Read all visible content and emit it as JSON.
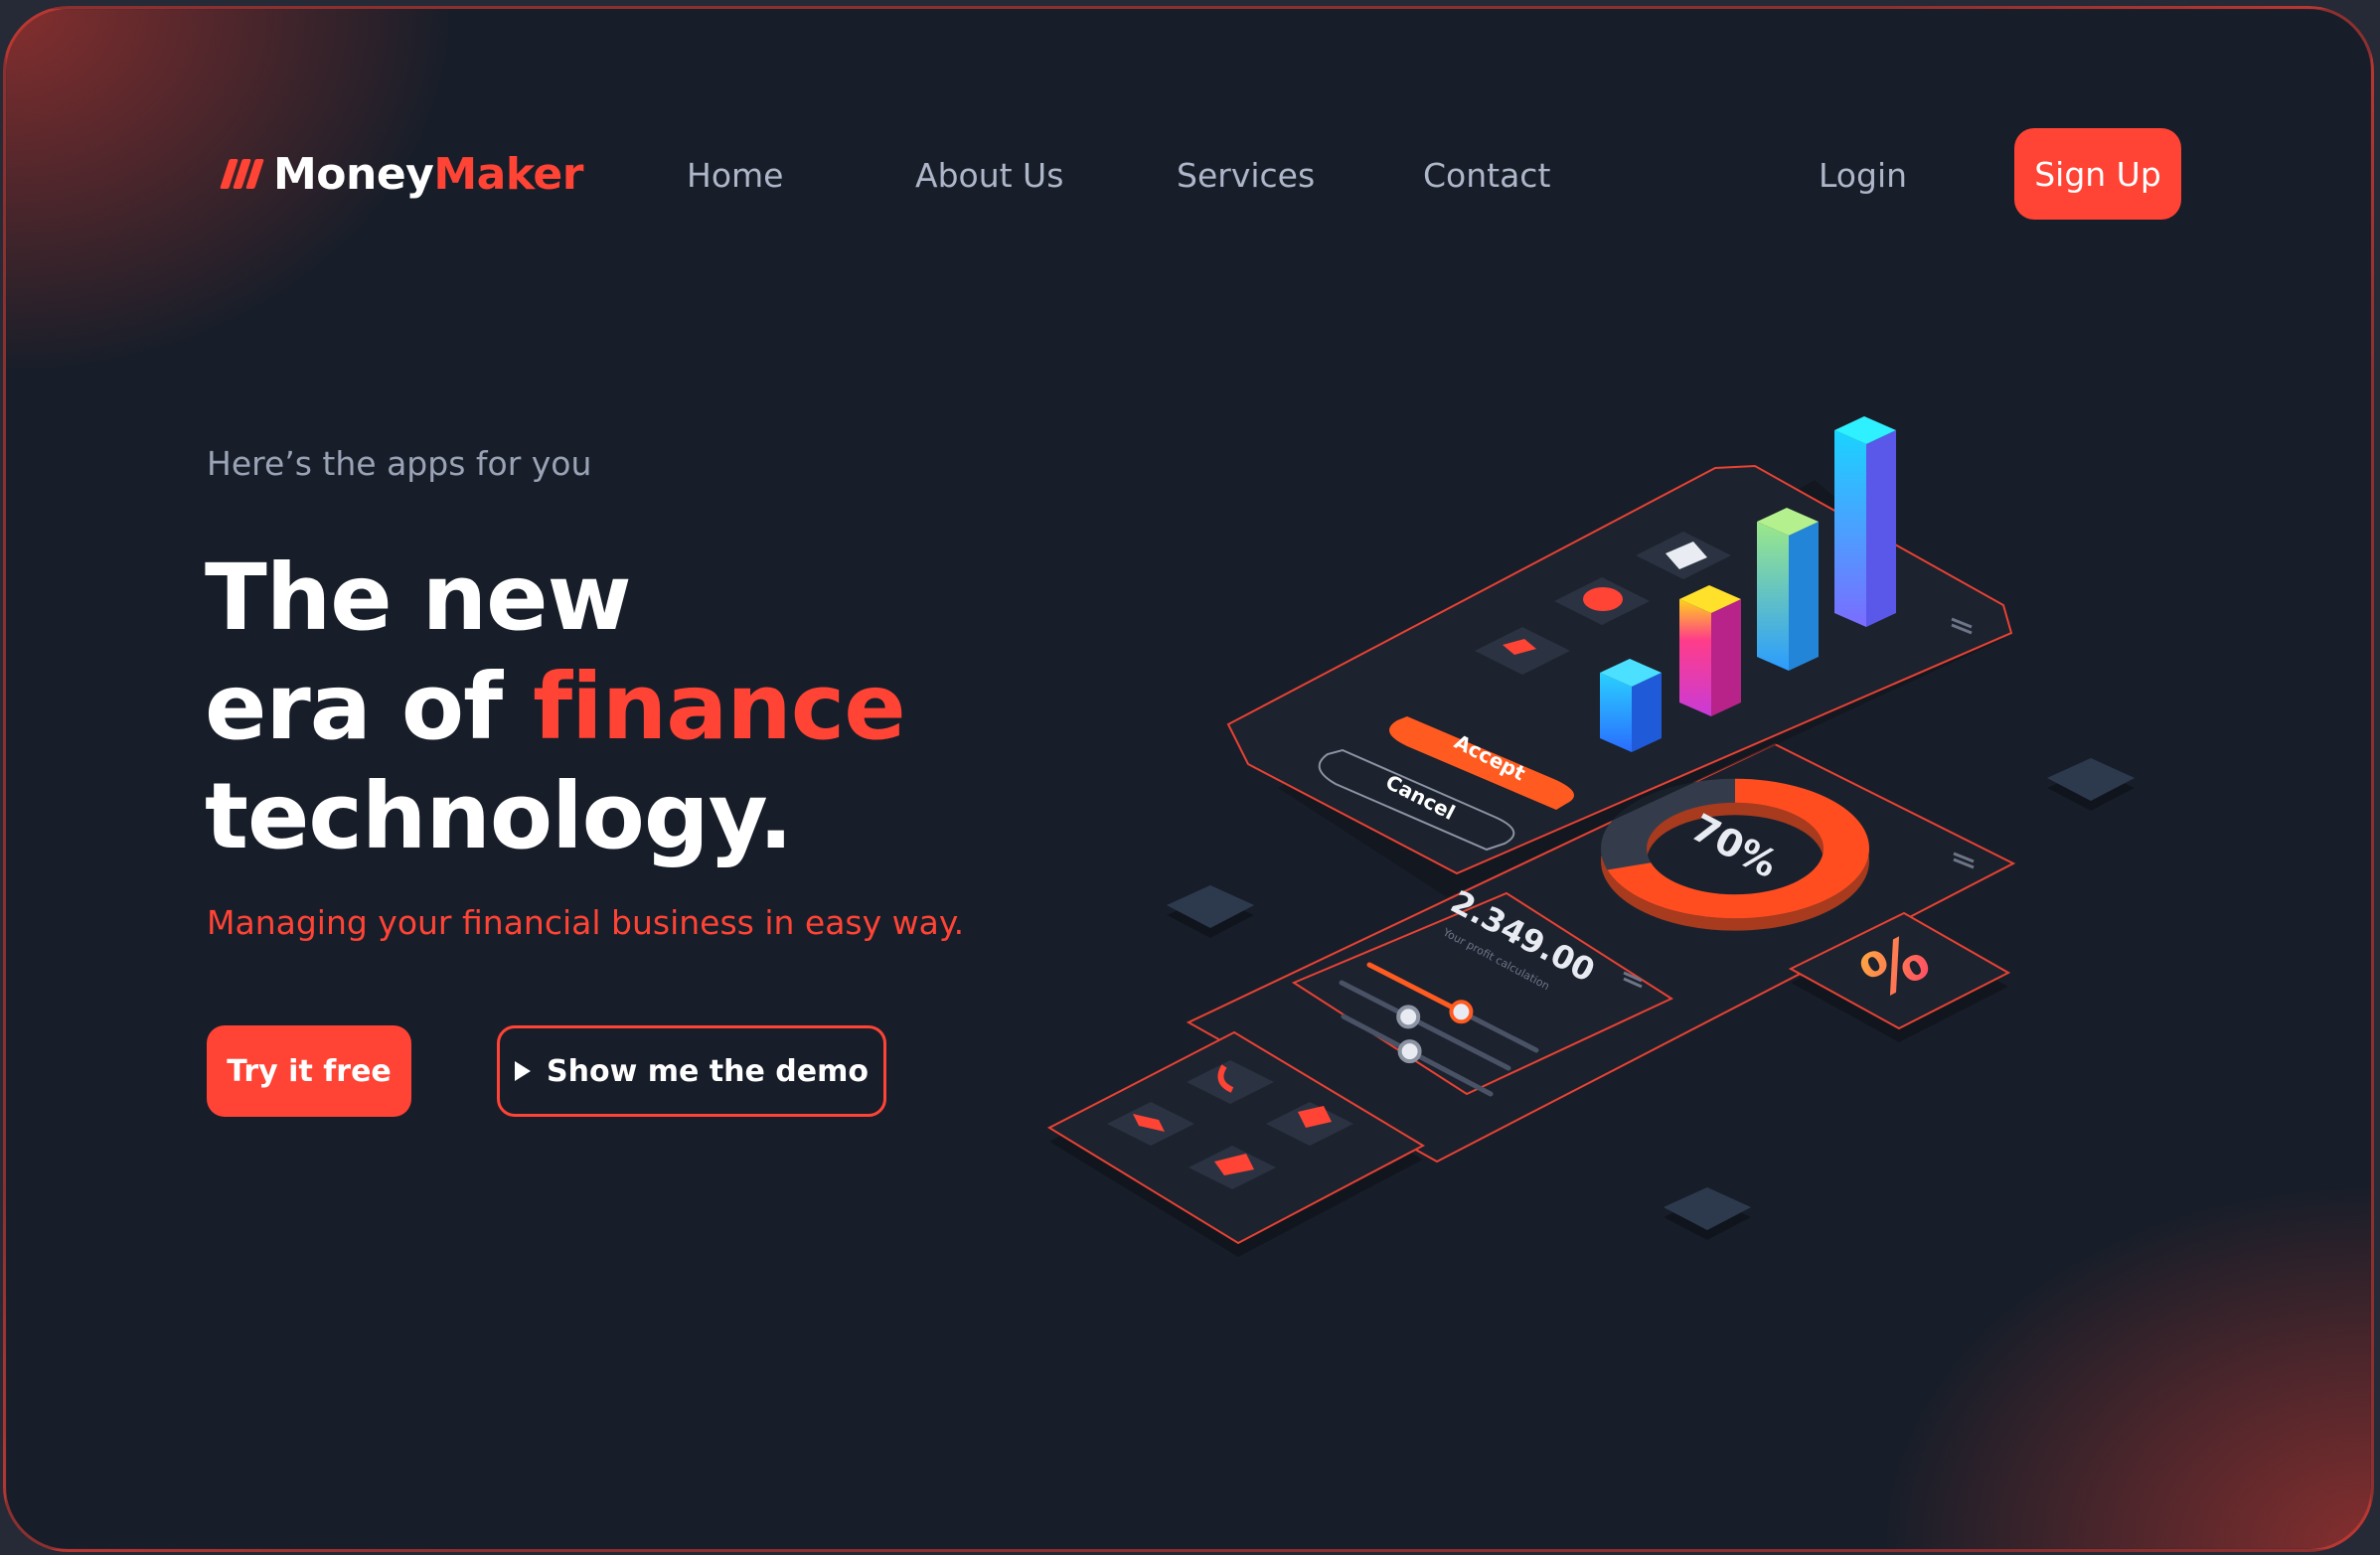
{
  "brand": {
    "part1": "Money",
    "part2": "Maker"
  },
  "nav": {
    "home": "Home",
    "about": "About Us",
    "services": "Services",
    "contact": "Contact",
    "login": "Login",
    "signup": "Sign Up"
  },
  "hero": {
    "eyebrow": "Here’s the apps for you",
    "headline_line1": "The new",
    "headline_line2_prefix": "era of ",
    "headline_highlight": "finance",
    "headline_line3": "technology.",
    "subline": "Managing your financial business in easy way.",
    "cta_primary": "Try it free",
    "cta_secondary": "Show me the demo"
  },
  "illustration": {
    "accept_label": "Accept",
    "cancel_label": "Cancel",
    "donut_percent_label": "70%",
    "donut_fill": 0.7,
    "amount": "2.349.00",
    "amount_caption": "Your profit calculation",
    "percent_tile_symbol": "%",
    "sliders": [
      0.55,
      0.4,
      0.45
    ],
    "icons": [
      "mail-icon",
      "location-pin-icon",
      "video-icon",
      "phone-icon",
      "camera-icon",
      "arrow-icon",
      "bookmark-icon"
    ]
  },
  "colors": {
    "accent": "#ff4335",
    "background": "#181e29",
    "text_muted": "#aeb6c9"
  }
}
